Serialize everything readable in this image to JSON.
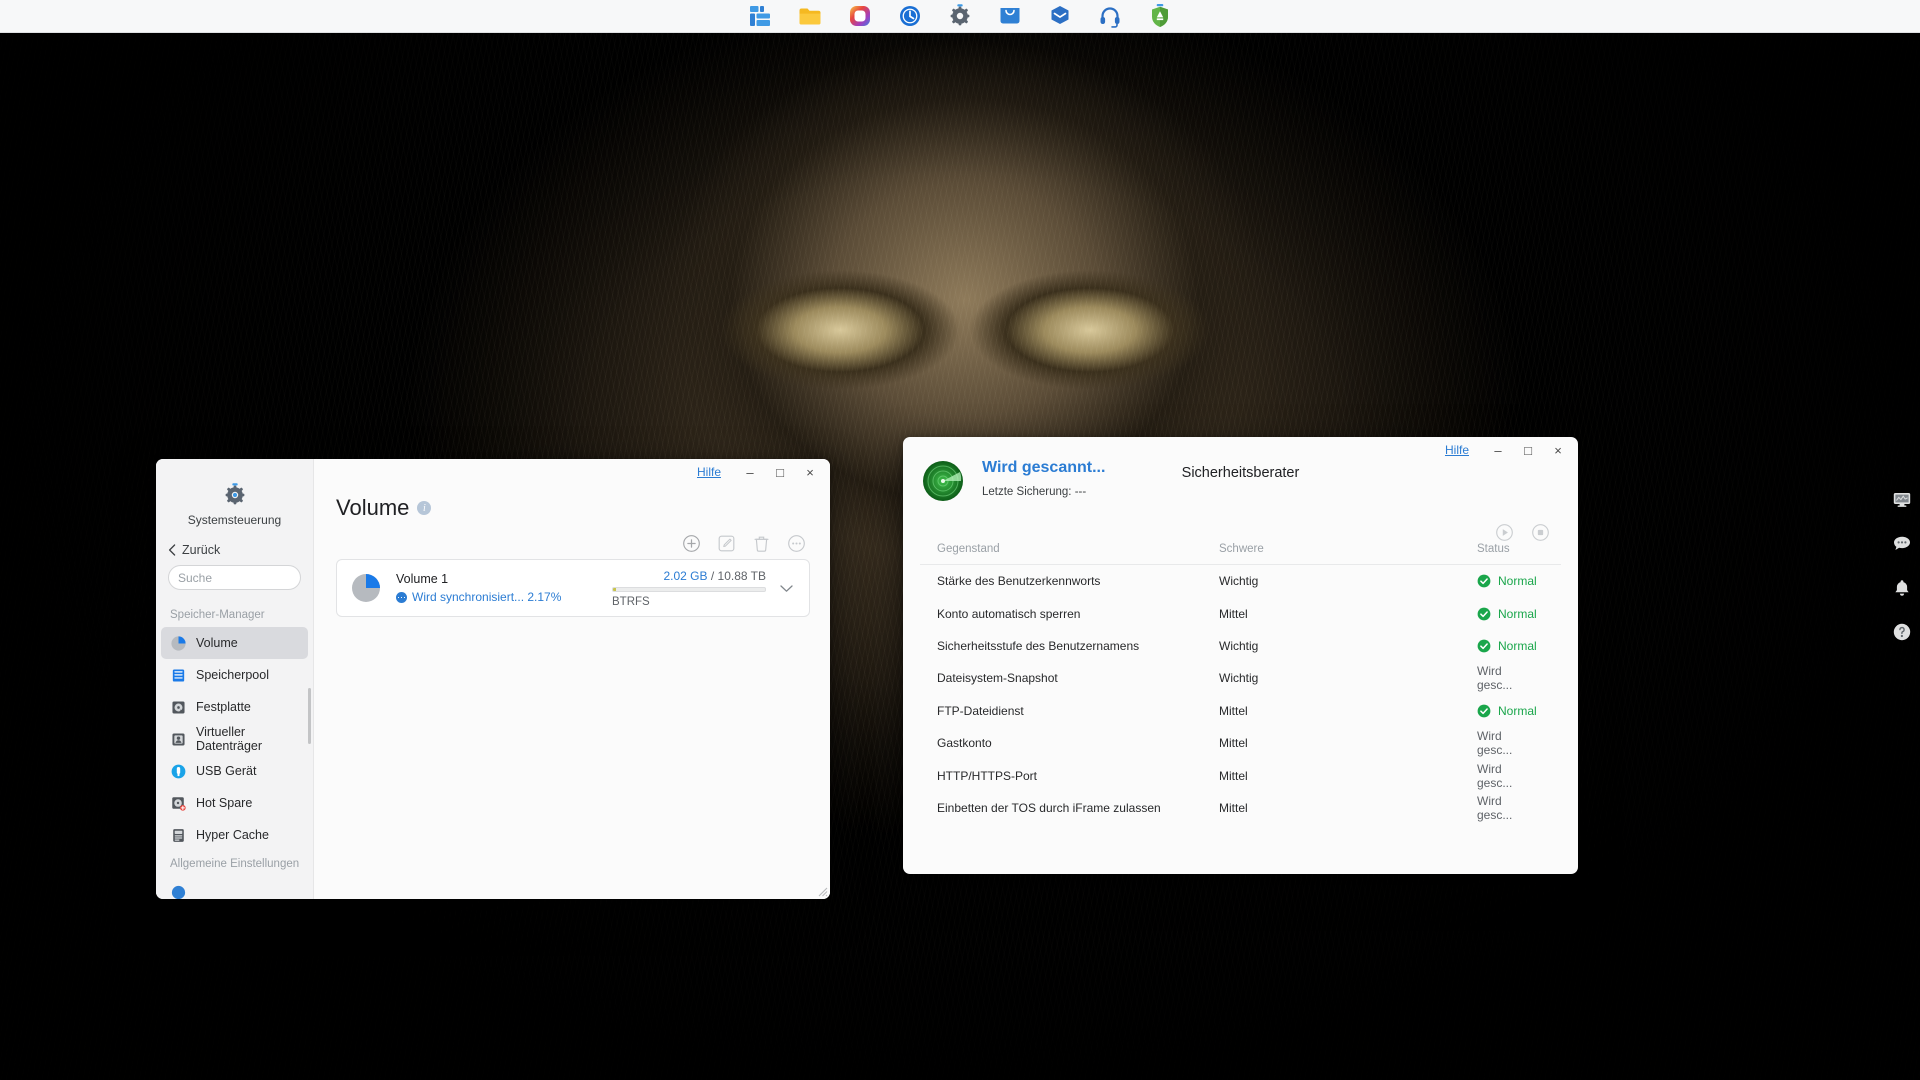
{
  "taskbar": {
    "items": [
      {
        "name": "package-center-icon",
        "label": "Paket-Zentrum"
      },
      {
        "name": "file-station-folder-icon",
        "label": "File Station"
      },
      {
        "name": "photos-icon",
        "label": "Synology Photos"
      },
      {
        "name": "time-backup-icon",
        "label": "Active Backup"
      },
      {
        "name": "control-panel-gear-icon",
        "label": "Systemsteuerung"
      },
      {
        "name": "download-station-icon",
        "label": "Download Station"
      },
      {
        "name": "mail-plus-icon",
        "label": "Synology MailPlus"
      },
      {
        "name": "audio-station-headphones-icon",
        "label": "Audio Station"
      },
      {
        "name": "security-advisor-shield-icon",
        "label": "Sicherheitsberater"
      }
    ]
  },
  "volume_window": {
    "titlebar": {
      "help_label": "Hilfe",
      "minimize_label": "–",
      "maximize_label": "□",
      "close_label": "×"
    },
    "app_name": "Systemsteuerung",
    "back_label": "Zurück",
    "search": {
      "value": "",
      "placeholder": "Suche"
    },
    "page_title": "Volume",
    "info_label": "i",
    "toolbar": [
      {
        "name": "add-volume-button",
        "label": "Erstellen"
      },
      {
        "name": "edit-volume-button",
        "label": "Bearbeiten"
      },
      {
        "name": "delete-volume-button",
        "label": "Entfernen"
      },
      {
        "name": "more-actions-button",
        "label": "Mehr"
      }
    ],
    "sidebar": {
      "groups": [
        {
          "title": "Speicher-Manager",
          "items": [
            {
              "label": "Volume",
              "icon": "volume-pie-icon",
              "active": true
            },
            {
              "label": "Speicherpool",
              "icon": "storage-pool-icon",
              "active": false
            },
            {
              "label": "Festplatte",
              "icon": "hard-disk-icon",
              "active": false
            },
            {
              "label": "Virtueller Datenträger",
              "icon": "virtual-disk-icon",
              "active": false
            },
            {
              "label": "USB Gerät",
              "icon": "usb-device-icon",
              "active": false
            },
            {
              "label": "Hot Spare",
              "icon": "hot-spare-icon",
              "active": false
            },
            {
              "label": "Hyper Cache",
              "icon": "hyper-cache-icon",
              "active": false
            }
          ]
        },
        {
          "title": "Allgemeine Einstellungen",
          "items": []
        }
      ]
    },
    "volume_row": {
      "name": "Volume 1",
      "status": "Wird synchronisiert... 2.17%",
      "used": "2.02 GB",
      "separator": "/",
      "total": "10.88 TB",
      "filesystem": "BTRFS",
      "progress_percent": 2.17,
      "chevron": "⌵"
    }
  },
  "security_window": {
    "titlebar": {
      "help_label": "Hilfe",
      "minimize_label": "–",
      "maximize_label": "□",
      "close_label": "×"
    },
    "title": "Sicherheitsberater",
    "scan_status": "Wird gescannt...",
    "last_backup": "Letzte Sicherung: ---",
    "actions": [
      {
        "name": "start-scan-button",
        "label": "Scan starten"
      },
      {
        "name": "stop-scan-button",
        "label": "Scan stoppen"
      }
    ],
    "table": {
      "columns": [
        "Gegenstand",
        "Schwere",
        "Status"
      ],
      "rows": [
        {
          "item": "Stärke des Benutzerkennworts",
          "severity": "Wichtig",
          "status": "Normal",
          "state": "ok"
        },
        {
          "item": "Konto automatisch sperren",
          "severity": "Mittel",
          "status": "Normal",
          "state": "ok"
        },
        {
          "item": "Sicherheitsstufe des Benutzernamens",
          "severity": "Wichtig",
          "status": "Normal",
          "state": "ok"
        },
        {
          "item": "Dateisystem-Snapshot",
          "severity": "Wichtig",
          "status": "Wird gesc...",
          "state": "pending"
        },
        {
          "item": "FTP-Dateidienst",
          "severity": "Mittel",
          "status": "Normal",
          "state": "ok"
        },
        {
          "item": "Gastkonto",
          "severity": "Mittel",
          "status": "Wird gesc...",
          "state": "pending"
        },
        {
          "item": "HTTP/HTTPS-Port",
          "severity": "Mittel",
          "status": "Wird gesc...",
          "state": "pending"
        },
        {
          "item": "Einbetten der TOS durch iFrame zulassen",
          "severity": "Mittel",
          "status": "Wird gesc...",
          "state": "pending"
        }
      ]
    }
  },
  "right_dock": {
    "items": [
      {
        "name": "resource-monitor-icon",
        "label": "Ressourcenmonitor"
      },
      {
        "name": "chat-bubble-icon",
        "label": "Chat"
      },
      {
        "name": "notification-bell-icon",
        "label": "Benachrichtigungen"
      },
      {
        "name": "help-question-icon",
        "label": "Hilfe"
      }
    ]
  },
  "colors": {
    "accent_blue": "#2b7cd3",
    "status_green": "#1aa64b",
    "progress_yellow": "#c8c44a",
    "sidebar_bg": "#f3f3f4",
    "active_item": "#d9dade"
  }
}
